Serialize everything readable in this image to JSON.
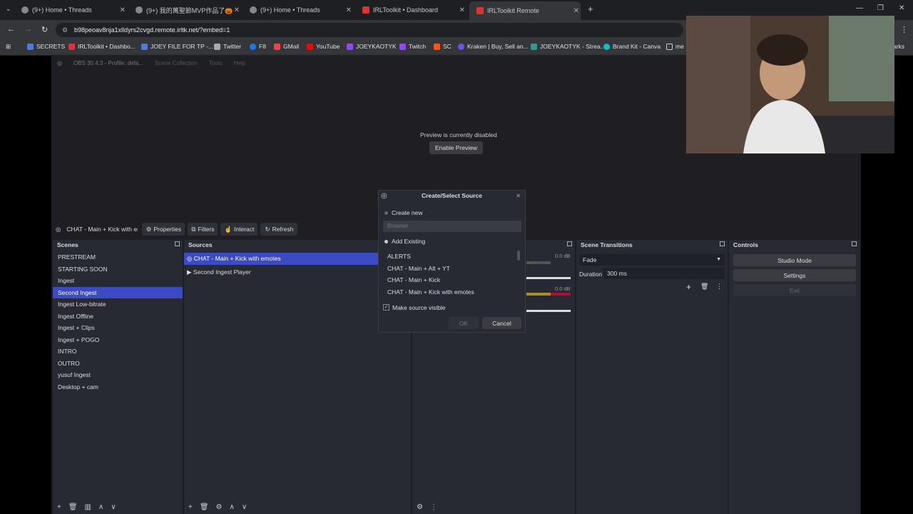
{
  "browser": {
    "tabs": [
      {
        "label": "(9+) Home • Threads"
      },
      {
        "label": "(9+) 我的萬聖節MVP作品了🎃"
      },
      {
        "label": "(9+) Home • Threads"
      },
      {
        "label": "IRLToolkit • Dashboard"
      },
      {
        "label": "IRLToolkit Remote"
      }
    ],
    "url": "b98peoav8nja1xlldyrs2cvgd.remote.irltk.net/?embed=1",
    "bookmarks": [
      "SECRETS",
      "IRLToolkit • Dashbo...",
      "JOEY FILE FOR TP -...",
      "Twitter",
      "F8",
      "GMail",
      "YouTube",
      "JOEYKAOTYK",
      "Twitch",
      "SC",
      "Kraken | Buy, Sell an...",
      "JOEYKAOTYK - Strea...",
      "Brand Kit - Canva",
      "me",
      "arks"
    ]
  },
  "obs": {
    "title": "OBS 30.4.3 - Profile: defa...",
    "menu": [
      "Scene Collection",
      "Tools",
      "Help"
    ],
    "preview_msg": "Preview is currently disabled",
    "enable_preview": "Enable Preview",
    "source_toolbar": {
      "current_source": "CHAT - Main + Kick with em",
      "properties": "Properties",
      "filters": "Filters",
      "interact": "Interact",
      "refresh": "Refresh"
    },
    "scenes": {
      "title": "Scenes",
      "items": [
        "PRESTREAM",
        "STARTING SOON",
        "Ingest",
        "Second Ingest",
        "Ingest Low-bitrate",
        "Ingest Offline",
        "Ingest + Clips",
        "Ingest + POGO",
        "INTRO",
        "OUTRO",
        "yusuf Ingest",
        "Desktop + cam"
      ],
      "selected_index": 3
    },
    "sources": {
      "title": "Sources",
      "items": [
        "CHAT - Main + Kick with emotes",
        "Second Ingest Player"
      ]
    },
    "mixer": {
      "db1": "0.0 dB",
      "db2": "0.0 dB"
    },
    "transitions": {
      "title": "Scene Transitions",
      "value": "Fade",
      "duration_label": "Duration",
      "duration_value": "300 ms"
    },
    "controls": {
      "title": "Controls",
      "studio_mode": "Studio Mode",
      "settings": "Settings",
      "exit": "Exit"
    }
  },
  "dialog": {
    "title": "Create/Select Source",
    "create_new": "Create new",
    "name_placeholder": "Browser",
    "add_existing": "Add Existing",
    "existing": [
      "ALERTS",
      "CHAT - Main + Alt + YT",
      "CHAT - Main + Kick",
      "CHAT - Main + Kick with emotes"
    ],
    "make_visible": "Make source visible",
    "ok": "OK",
    "cancel": "Cancel"
  },
  "colors": {
    "accent": "#3b4ac5",
    "panel": "#272a33",
    "bg": "#1f1f23"
  }
}
